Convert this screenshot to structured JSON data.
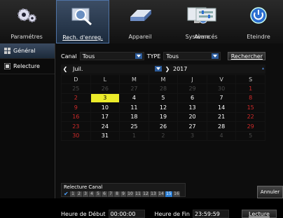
{
  "tabs": [
    {
      "label": "Paramétres",
      "icon": "gear-icon"
    },
    {
      "label": "Rech. d'enreg.",
      "icon": "search-record-icon"
    },
    {
      "label": "Appareil",
      "icon": "hard-drive-icon"
    },
    {
      "label": "Système",
      "icon": "monitor-info-icon"
    },
    {
      "label": "Avancés",
      "icon": "advanced-settings-icon"
    },
    {
      "label": "Eteindre",
      "icon": "power-icon"
    }
  ],
  "sidebar": {
    "items": [
      {
        "label": "Général",
        "icon": "grid-icon"
      },
      {
        "label": "Relecture",
        "icon": "film-icon"
      }
    ]
  },
  "filters": {
    "canal_label": "Canal",
    "canal_value": "Tous",
    "type_label": "TYPE",
    "type_value": "Tous",
    "search_button": "Rechercher"
  },
  "calendar": {
    "month": "Juil.",
    "year": "2017",
    "weekdays": [
      "D",
      "L",
      "M",
      "M",
      "J",
      "V",
      "S"
    ],
    "weeks": [
      [
        "25",
        "26",
        "27",
        "28",
        "29",
        "30",
        "1"
      ],
      [
        "2",
        "3",
        "4",
        "5",
        "6",
        "7",
        "8"
      ],
      [
        "9",
        "10",
        "11",
        "12",
        "13",
        "14",
        "15"
      ],
      [
        "16",
        "17",
        "18",
        "19",
        "20",
        "21",
        "22"
      ],
      [
        "23",
        "24",
        "25",
        "26",
        "27",
        "28",
        "29"
      ],
      [
        "30",
        "31",
        "1",
        "2",
        "3",
        "4",
        "5"
      ]
    ],
    "selected_day": "3"
  },
  "relecture_canal": {
    "title": "Relecture Canal",
    "channels": [
      "1",
      "2",
      "3",
      "4",
      "5",
      "6",
      "7",
      "8",
      "9",
      "10",
      "11",
      "12",
      "13",
      "14",
      "15",
      "16"
    ],
    "selected_channel": "15"
  },
  "time": {
    "start_label": "Heure de Début",
    "start_value": "00:00:00",
    "end_label": "Heure de Fin",
    "end_value": "23:59:59",
    "play_button": "Lecture"
  },
  "annuler_button": "Annuler",
  "colors": {
    "accent": "#2c5b9a",
    "selected_day": "#ecec2a",
    "weekend": "#d02a2a"
  }
}
